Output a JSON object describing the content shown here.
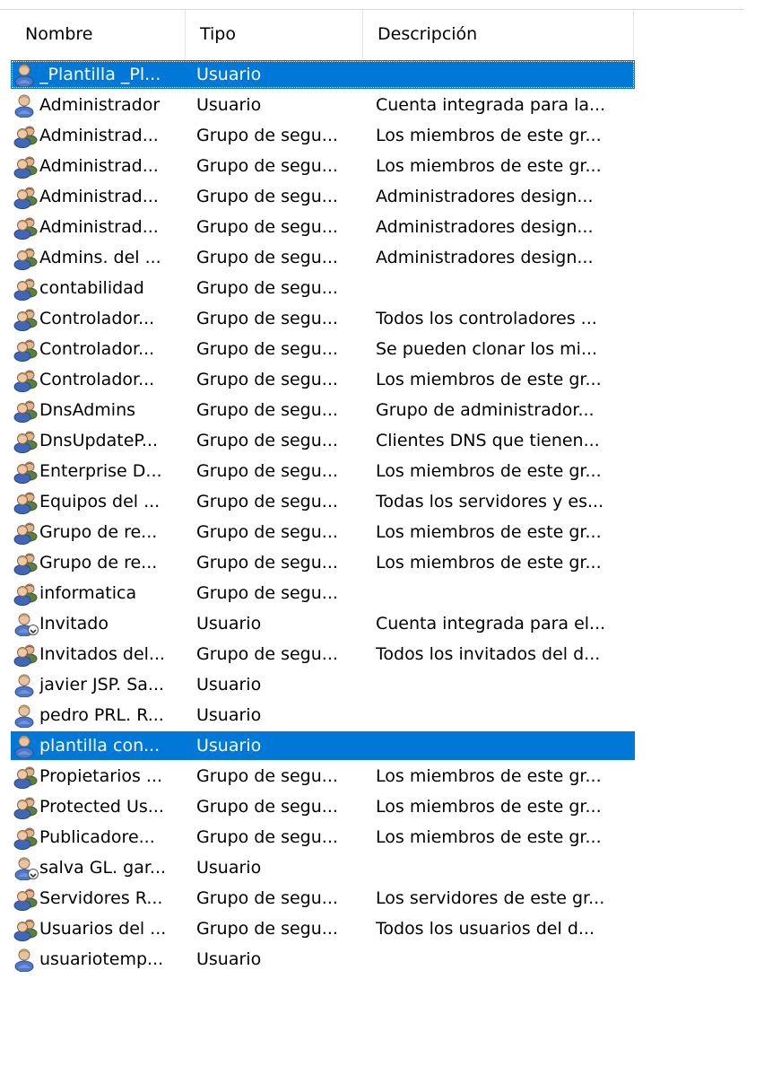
{
  "columns": {
    "name": "Nombre",
    "type": "Tipo",
    "description": "Descripción"
  },
  "selection_color": "#0078d7",
  "icons": {
    "user": "user-icon",
    "group": "group-icon",
    "user_disabled": "user-disabled-icon"
  },
  "rows": [
    {
      "icon": "user",
      "name": "_Plantilla _Pl...",
      "type": "Usuario",
      "description": "",
      "selected": true
    },
    {
      "icon": "user",
      "name": "Administrador",
      "type": "Usuario",
      "description": "Cuenta integrada para la..."
    },
    {
      "icon": "group",
      "name": "Administrad...",
      "type": "Grupo de segu...",
      "description": "Los miembros de este gr..."
    },
    {
      "icon": "group",
      "name": "Administrad...",
      "type": "Grupo de segu...",
      "description": "Los miembros de este gr..."
    },
    {
      "icon": "group",
      "name": "Administrad...",
      "type": "Grupo de segu...",
      "description": "Administradores design..."
    },
    {
      "icon": "group",
      "name": "Administrad...",
      "type": "Grupo de segu...",
      "description": "Administradores design..."
    },
    {
      "icon": "group",
      "name": "Admins. del ...",
      "type": "Grupo de segu...",
      "description": "Administradores design..."
    },
    {
      "icon": "group",
      "name": "contabilidad",
      "type": "Grupo de segu...",
      "description": ""
    },
    {
      "icon": "group",
      "name": "Controlador...",
      "type": "Grupo de segu...",
      "description": "Todos los controladores ..."
    },
    {
      "icon": "group",
      "name": "Controlador...",
      "type": "Grupo de segu...",
      "description": "Se pueden clonar los mi..."
    },
    {
      "icon": "group",
      "name": "Controlador...",
      "type": "Grupo de segu...",
      "description": "Los miembros de este gr..."
    },
    {
      "icon": "group",
      "name": "DnsAdmins",
      "type": "Grupo de segu...",
      "description": "Grupo de administrador..."
    },
    {
      "icon": "group",
      "name": "DnsUpdateP...",
      "type": "Grupo de segu...",
      "description": "Clientes DNS que tienen..."
    },
    {
      "icon": "group",
      "name": "Enterprise D...",
      "type": "Grupo de segu...",
      "description": "Los miembros de este gr..."
    },
    {
      "icon": "group",
      "name": "Equipos del ...",
      "type": "Grupo de segu...",
      "description": "Todas los servidores y es..."
    },
    {
      "icon": "group",
      "name": "Grupo de re...",
      "type": "Grupo de segu...",
      "description": "Los miembros de este gr..."
    },
    {
      "icon": "group",
      "name": "Grupo de re...",
      "type": "Grupo de segu...",
      "description": "Los miembros de este gr..."
    },
    {
      "icon": "group",
      "name": "informatica",
      "type": "Grupo de segu...",
      "description": ""
    },
    {
      "icon": "user_disabled",
      "name": "Invitado",
      "type": "Usuario",
      "description": "Cuenta integrada para el..."
    },
    {
      "icon": "group",
      "name": "Invitados del...",
      "type": "Grupo de segu...",
      "description": "Todos los invitados del d..."
    },
    {
      "icon": "user",
      "name": "javier JSP. Sa...",
      "type": "Usuario",
      "description": ""
    },
    {
      "icon": "user",
      "name": "pedro PRL. R...",
      "type": "Usuario",
      "description": ""
    },
    {
      "icon": "user",
      "name": "plantilla con...",
      "type": "Usuario",
      "description": "",
      "selected": true
    },
    {
      "icon": "group",
      "name": "Propietarios ...",
      "type": "Grupo de segu...",
      "description": "Los miembros de este gr..."
    },
    {
      "icon": "group",
      "name": "Protected Us...",
      "type": "Grupo de segu...",
      "description": "Los miembros de este gr..."
    },
    {
      "icon": "group",
      "name": "Publicadore...",
      "type": "Grupo de segu...",
      "description": "Los miembros de este gr..."
    },
    {
      "icon": "user_disabled",
      "name": "salva GL. gar...",
      "type": "Usuario",
      "description": ""
    },
    {
      "icon": "group",
      "name": "Servidores R...",
      "type": "Grupo de segu...",
      "description": "Los servidores de este gr..."
    },
    {
      "icon": "group",
      "name": "Usuarios del ...",
      "type": "Grupo de segu...",
      "description": "Todos los usuarios del d..."
    },
    {
      "icon": "user",
      "name": "usuariotemp...",
      "type": "Usuario",
      "description": ""
    }
  ]
}
